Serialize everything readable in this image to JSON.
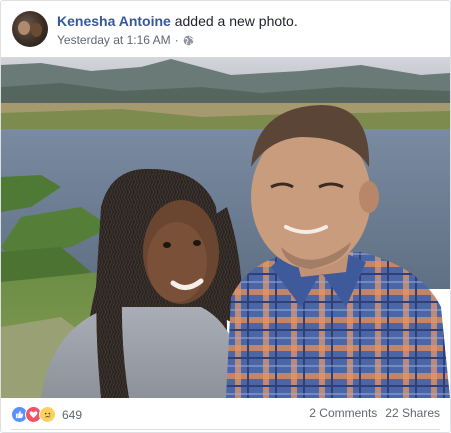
{
  "post": {
    "author_name": "Kenesha Antoine",
    "action_text": "added a new photo.",
    "timestamp": "Yesterday at 1:16 AM",
    "separator": "·",
    "privacy_icon": "globe-icon"
  },
  "photo": {
    "subject": "couple-selfie-by-lake",
    "colors": {
      "sky": "#c9ccd4",
      "mountains": "#5d6d6a",
      "water": "#6f7f93",
      "grass": "#4f7b38",
      "shirt_blue": "#4d6aa8",
      "shirt_orange": "#d88a5a",
      "hoodie": "#9a9ea6",
      "skin_light": "#c9a080",
      "skin_dark": "#6a4530",
      "hair_dark": "#2b2520"
    }
  },
  "footer": {
    "reactions": [
      "like-icon",
      "love-icon",
      "sad-icon"
    ],
    "reaction_count": "649",
    "comments": "2 Comments",
    "shares": "22 Shares"
  },
  "colors": {
    "link_blue": "#365899",
    "meta_gray": "#616770",
    "like_blue": "#5890ff",
    "love_red": "#f25268",
    "sad_yellow": "#fcd15f"
  }
}
